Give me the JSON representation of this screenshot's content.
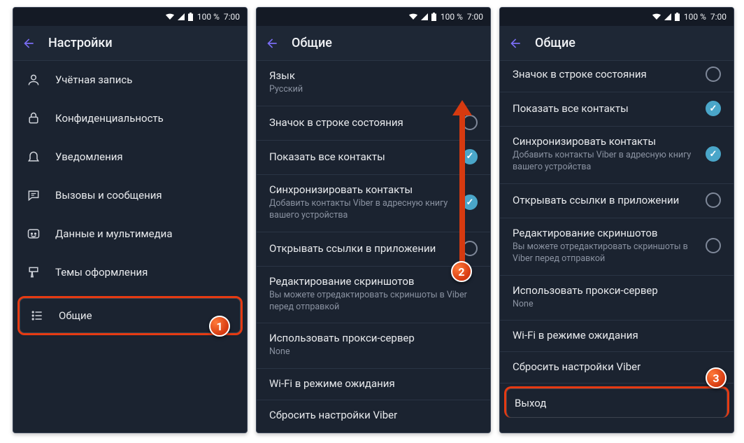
{
  "statusbar": {
    "battery": "100 %",
    "time": "7:00"
  },
  "screen1": {
    "title": "Настройки",
    "items": [
      {
        "key": "account",
        "label": "Учётная запись"
      },
      {
        "key": "privacy",
        "label": "Конфиденциальность"
      },
      {
        "key": "notif",
        "label": "Уведомления"
      },
      {
        "key": "calls",
        "label": "Вызовы и сообщения"
      },
      {
        "key": "data",
        "label": "Данные и мультимедиа"
      },
      {
        "key": "themes",
        "label": "Темы оформления"
      },
      {
        "key": "general",
        "label": "Общие"
      }
    ]
  },
  "screen2": {
    "title": "Общие",
    "lang": {
      "title": "Язык",
      "sub": "Русский"
    },
    "status": {
      "title": "Значок в строке состояния",
      "checked": false
    },
    "showall": {
      "title": "Показать все контакты",
      "checked": true
    },
    "sync": {
      "title": "Синхронизировать контакты",
      "sub": "Добавить контакты Viber в адресную книгу вашего устройства",
      "checked": true
    },
    "links": {
      "title": "Открывать ссылки в приложении",
      "checked": false
    },
    "shots": {
      "title": "Редактирование скриншотов",
      "sub": "Вы можете отредактировать скриншоты в Viber перед отправкой"
    },
    "proxy": {
      "title": "Использовать прокси-сервер",
      "sub": "None"
    },
    "wifi": {
      "title": "Wi-Fi в режиме ожидания"
    },
    "reset": {
      "title": "Сбросить настройки Viber"
    }
  },
  "screen3": {
    "title": "Общие",
    "status": {
      "title": "Значок в строке состояния",
      "checked": false
    },
    "showall": {
      "title": "Показать все контакты",
      "checked": true
    },
    "sync": {
      "title": "Синхронизировать контакты",
      "sub": "Добавить контакты Viber в адресную книгу вашего устройства",
      "checked": true
    },
    "links": {
      "title": "Открывать ссылки в приложении",
      "checked": false
    },
    "shots": {
      "title": "Редактирование скриншотов",
      "sub": "Вы можете отредактировать скриншоты в Viber перед отправкой",
      "checked": false
    },
    "proxy": {
      "title": "Использовать прокси-сервер",
      "sub": "None"
    },
    "wifi": {
      "title": "Wi-Fi в режиме ожидания"
    },
    "reset": {
      "title": "Сбросить настройки Viber"
    },
    "exit": {
      "title": "Выход"
    }
  },
  "badges": {
    "b1": "1",
    "b2": "2",
    "b3": "3"
  }
}
